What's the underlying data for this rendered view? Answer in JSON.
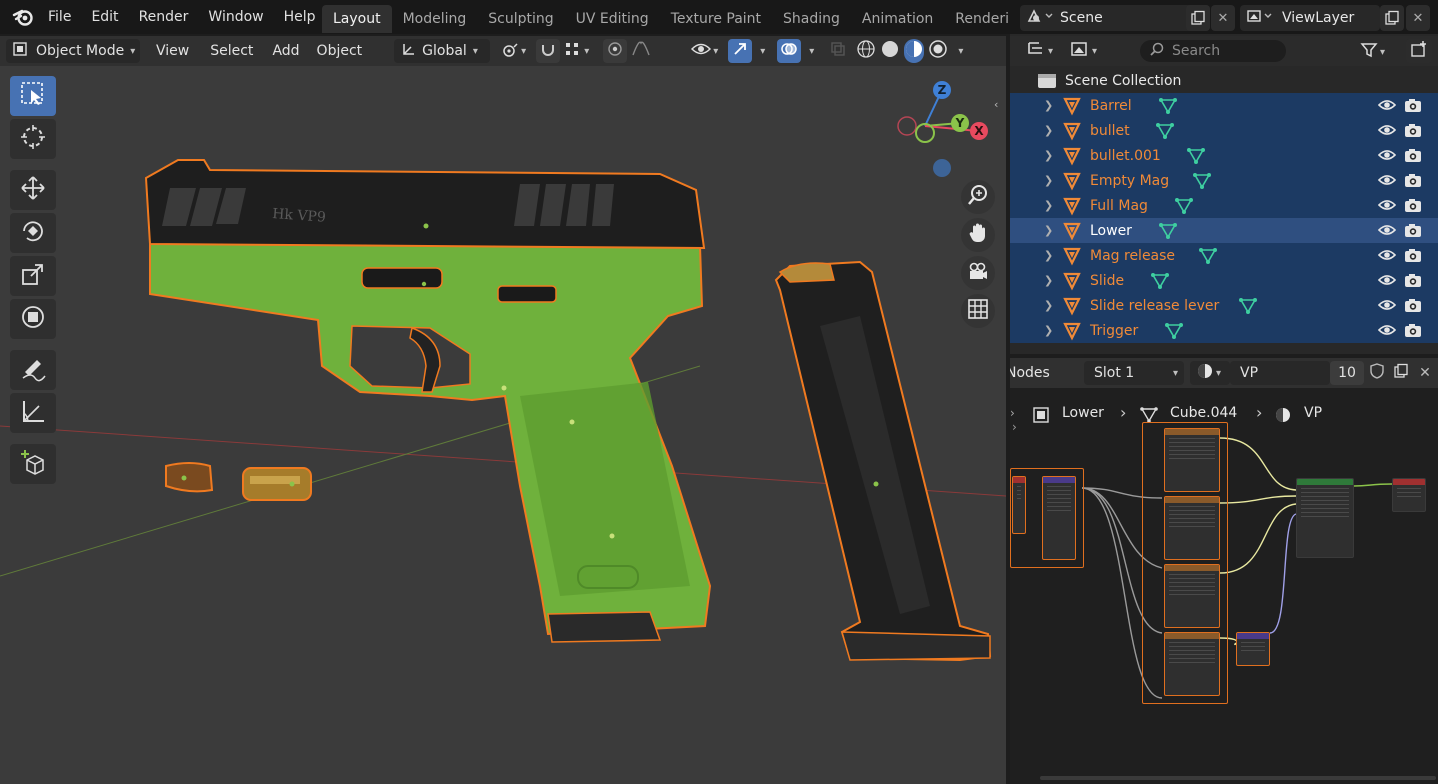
{
  "menubar": {
    "items": [
      "File",
      "Edit",
      "Render",
      "Window",
      "Help"
    ]
  },
  "workspaces": {
    "tabs": [
      "Layout",
      "Modeling",
      "Sculpting",
      "UV Editing",
      "Texture Paint",
      "Shading",
      "Animation",
      "Rendering"
    ],
    "active": "Layout"
  },
  "scene": {
    "name": "Scene"
  },
  "view_layer": {
    "name": "ViewLayer"
  },
  "viewport_header": {
    "mode": "Object Mode",
    "menus": [
      "View",
      "Select",
      "Add",
      "Object"
    ],
    "orientation": "Global"
  },
  "outliner": {
    "search_placeholder": "Search",
    "collection": "Scene Collection",
    "items": [
      {
        "name": "Barrel",
        "state": "selected"
      },
      {
        "name": "bullet",
        "state": "selected"
      },
      {
        "name": "bullet.001",
        "state": "selected"
      },
      {
        "name": "Empty Mag",
        "state": "selected"
      },
      {
        "name": "Full Mag",
        "state": "selected"
      },
      {
        "name": "Lower",
        "state": "active"
      },
      {
        "name": "Mag release",
        "state": "selected"
      },
      {
        "name": "Slide",
        "state": "selected"
      },
      {
        "name": "Slide release lever",
        "state": "selected"
      },
      {
        "name": "Trigger",
        "state": "selected"
      }
    ]
  },
  "shader_editor": {
    "editor_label": "Nodes",
    "slot": "Slot 1",
    "material": "VP",
    "users": "10",
    "breadcrumb": [
      "Lower",
      "Cube.044",
      "VP"
    ]
  },
  "gizmo": {
    "axes": [
      "Z",
      "Y",
      "X"
    ]
  },
  "colors": {
    "accent": "#4772b3",
    "selected_row": "#1c3a63",
    "active_row": "#2f4f80",
    "object_name": "#f08a38",
    "outline": "#f07a20",
    "axis_x": "#e84a5f",
    "axis_y": "#8bc34a",
    "axis_z": "#3f80d6"
  }
}
